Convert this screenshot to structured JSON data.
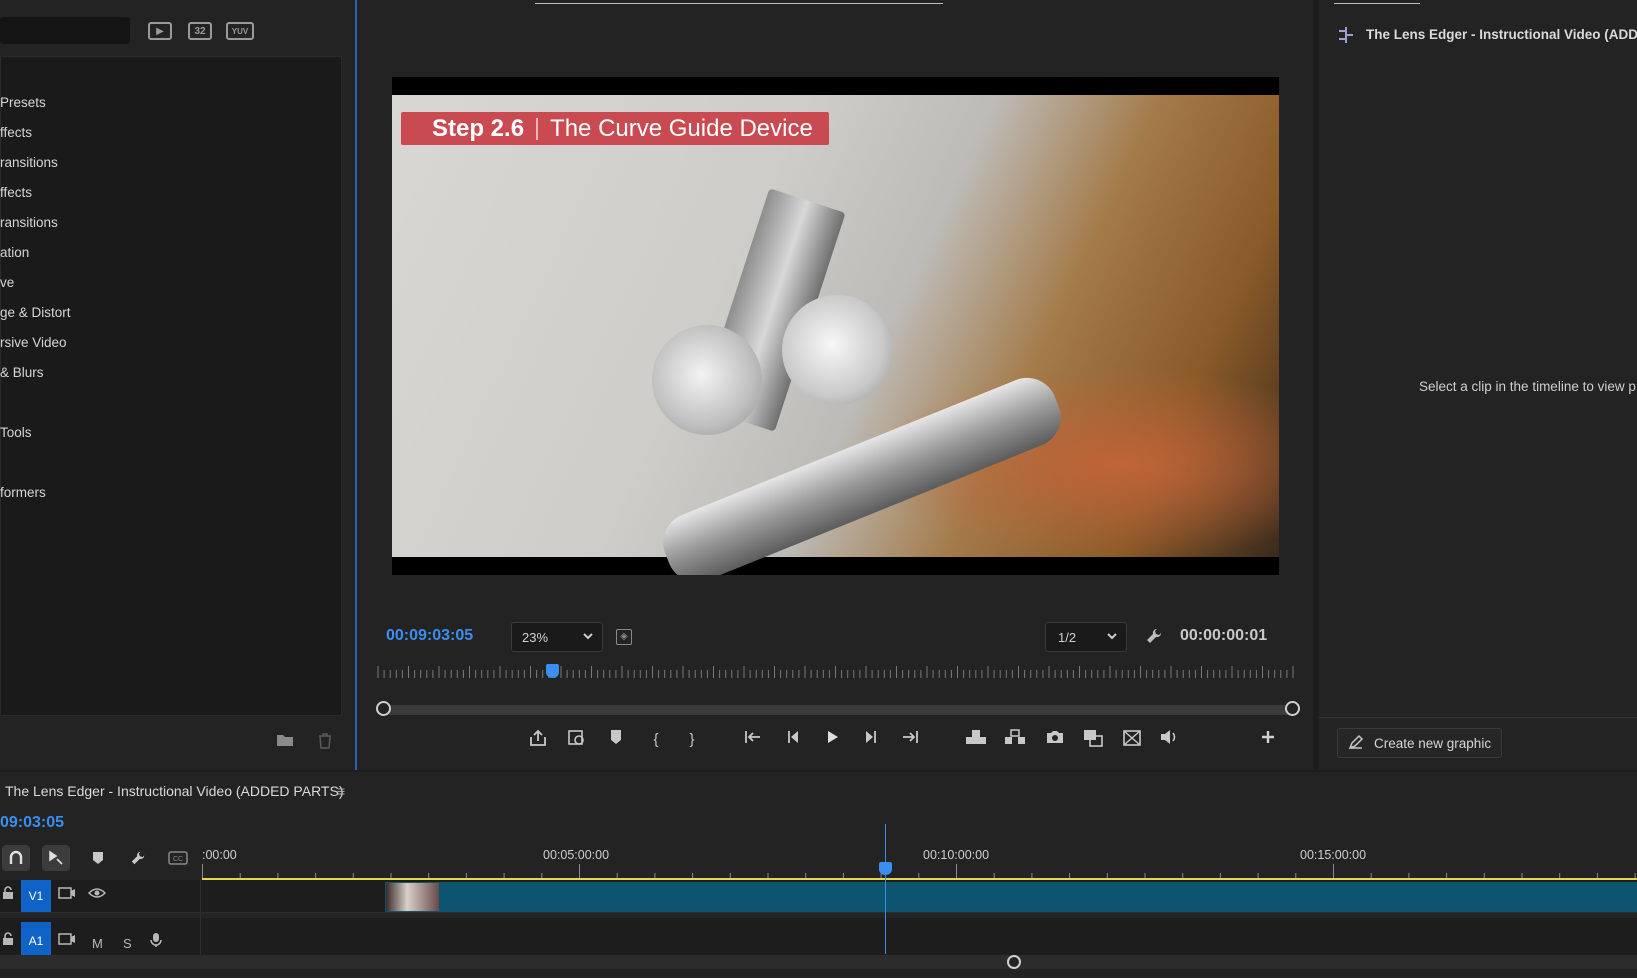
{
  "effects": {
    "toolbar_icons": [
      {
        "name": "accelerated-effects-icon",
        "glyph": "▶"
      },
      {
        "name": "32bit-effects-icon",
        "glyph": "32"
      },
      {
        "name": "yuv-effects-icon",
        "glyph": "YUV"
      }
    ],
    "items": [
      " Presets",
      "ffects",
      "ransitions",
      "ffects",
      "ransitions",
      "ation",
      "ve",
      "ge & Distort",
      "rsive Video",
      " & Blurs",
      " Tools",
      "formers"
    ]
  },
  "program": {
    "banner": {
      "step": "Step 2.6",
      "title": "The Curve Guide Device"
    },
    "timecode": "00:09:03:05",
    "zoom": "23%",
    "resolution": "1/2",
    "duration": "00:00:00:01",
    "playhead_fraction": 0.191
  },
  "graphics": {
    "sequence_title": "The Lens Edger - Instructional Video (ADDE",
    "hint": "Select a clip in the timeline to view p",
    "create_button": "Create new graphic"
  },
  "timeline": {
    "title": "The Lens Edger - Instructional Video (ADDED PARTS)",
    "menu": "≡",
    "timecode": "09:03:05",
    "time_labels": [
      ":00:00",
      "00:05:00:00",
      "00:10:00:00",
      "00:15:00:00"
    ],
    "tracks": {
      "video": {
        "label": "V1"
      },
      "audio": {
        "label": "A1",
        "mute": "M",
        "solo": "S"
      }
    }
  },
  "colors": {
    "accent": "#3b8ef0",
    "banner": "#c94a51",
    "clip": "#0c5470",
    "work_area": "#e3d74a",
    "track_target": "#0f63c6"
  }
}
